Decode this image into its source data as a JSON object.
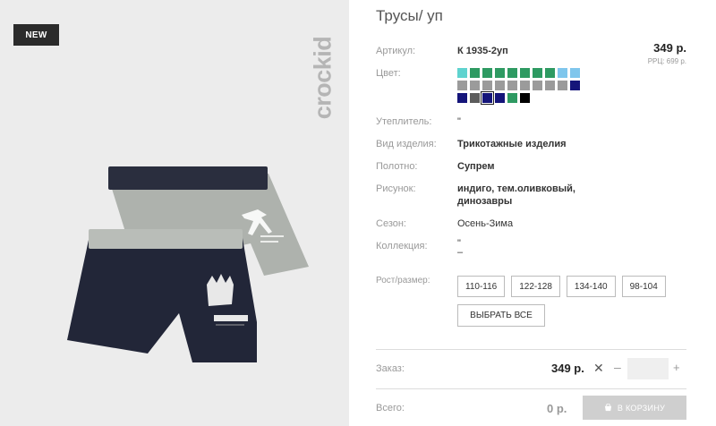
{
  "badge": "NEW",
  "brand": "crockid",
  "product": {
    "title": "Трусы/ уп",
    "price": "349 р.",
    "rrp": "РРЦ: 699 р.",
    "details": [
      {
        "label": "Артикул:",
        "value": "К 1935-2уп",
        "bold": true
      },
      {
        "label": "Цвет:",
        "value": "",
        "bold": false
      },
      {
        "label": "Утеплитель:",
        "value": "\"",
        "bold": false
      },
      {
        "label": "Вид изделия:",
        "value": "Трикотажные изделия",
        "bold": true
      },
      {
        "label": "Полотно:",
        "value": "Супрем",
        "bold": true
      },
      {
        "label": "Рисунок:",
        "value_lines": [
          "индиго, тем.оливковый,",
          "динозавры"
        ],
        "bold": true
      },
      {
        "label": "Сезон:",
        "value": "Осень-Зима",
        "bold": false
      },
      {
        "label": "Коллекция:",
        "value_lines": [
          "\"",
          "–"
        ],
        "bold": false
      },
      {
        "label": "Рост/размер:",
        "value": "",
        "bold": false
      }
    ],
    "swatch_rows": [
      [
        "#5fd3cf",
        "#2e9a62",
        "#2e9a62",
        "#2e9a62",
        "#2e9a62",
        "#2e9a62",
        "#2e9a62",
        "#2e9a62",
        "#7fc6ec",
        "#7fc6ec"
      ],
      [
        "#9b9b9b",
        "#9b9b9b",
        "#9b9b9b",
        "#9b9b9b",
        "#9b9b9b",
        "#9b9b9b",
        "#9b9b9b",
        "#9b9b9b",
        "#9b9b9b",
        "#15157a"
      ],
      [
        "#15157a",
        "#5c5c5c",
        "#15157a",
        "#15157a",
        "#2e9a62",
        "#000000"
      ]
    ],
    "selected_swatch": [
      2,
      2
    ],
    "sizes": [
      "110-116",
      "122-128",
      "134-140",
      "98-104"
    ],
    "select_all_label": "ВЫБРАТЬ ВСЕ"
  },
  "order": {
    "label": "Заказ:",
    "price": "349 р.",
    "minus": "–",
    "quantity": "",
    "plus": "+"
  },
  "total": {
    "label": "Всего:",
    "value": "0 р.",
    "cart_label": "В КОРЗИНУ"
  }
}
